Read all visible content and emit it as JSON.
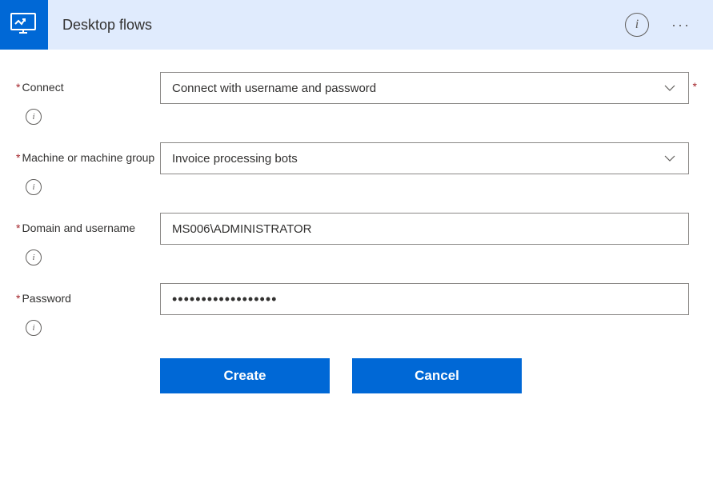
{
  "header": {
    "title": "Desktop flows",
    "icon": "monitor-flow-icon",
    "info_tooltip": "i",
    "more_label": "···"
  },
  "form": {
    "connect": {
      "label": "Connect",
      "value": "Connect with username and password",
      "required": true
    },
    "machine": {
      "label": "Machine or machine group",
      "value": "Invoice processing bots",
      "required": true
    },
    "domain_user": {
      "label": "Domain and username",
      "value": "MS006\\ADMINISTRATOR",
      "required": true
    },
    "password": {
      "label": "Password",
      "value_masked": "••••••••••••••••••",
      "required": true
    }
  },
  "buttons": {
    "create": "Create",
    "cancel": "Cancel"
  }
}
